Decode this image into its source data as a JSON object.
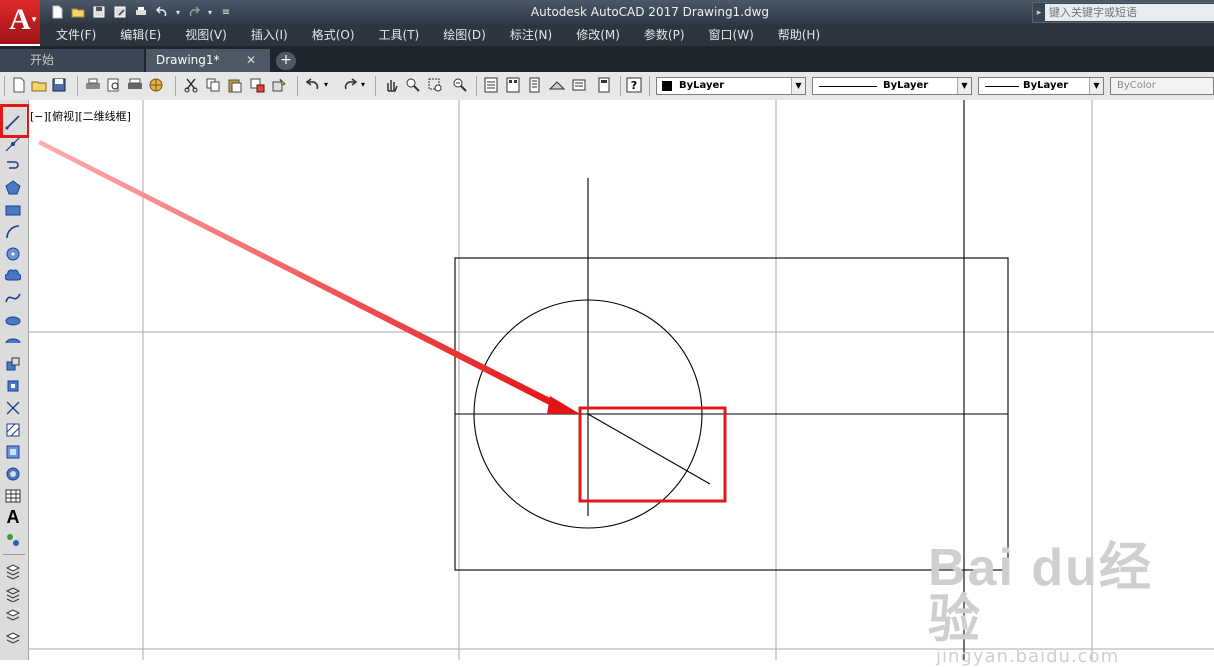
{
  "app": {
    "logo_letter": "A",
    "window_title": "Autodesk AutoCAD 2017    Drawing1.dwg",
    "search_placeholder": "键入关键字或短语"
  },
  "menu": [
    "文件(F)",
    "编辑(E)",
    "视图(V)",
    "插入(I)",
    "格式(O)",
    "工具(T)",
    "绘图(D)",
    "标注(N)",
    "修改(M)",
    "参数(P)",
    "窗口(W)",
    "帮助(H)"
  ],
  "tabs": {
    "start": "开始",
    "drawing": "Drawing1*",
    "close_glyph": "✕",
    "add_glyph": "+"
  },
  "properties": {
    "color": "ByLayer",
    "linetype": "ByLayer",
    "lineweight": "ByLayer",
    "plotstyle": "ByColor"
  },
  "viewport": {
    "label": "[−][俯视][二维线框]"
  },
  "left_tools": [
    "line",
    "construction-line",
    "polyline",
    "polygon",
    "rectangle",
    "arc",
    "circle",
    "revision-cloud",
    "spline",
    "ellipse",
    "ellipse-arc",
    "insert-block",
    "make-block",
    "point",
    "hatch",
    "gradient",
    "region",
    "table",
    "multiline-text",
    "add-selected",
    "tool-a",
    "tool-b",
    "tool-c",
    "tool-d"
  ],
  "colors": {
    "highlight": "#e01818",
    "canvas": "#ffffff",
    "grid": "#a9a9a9",
    "geometry": "#000000"
  },
  "watermark": {
    "logo": "Bai du经验",
    "url": "jingyan.baidu.com"
  }
}
